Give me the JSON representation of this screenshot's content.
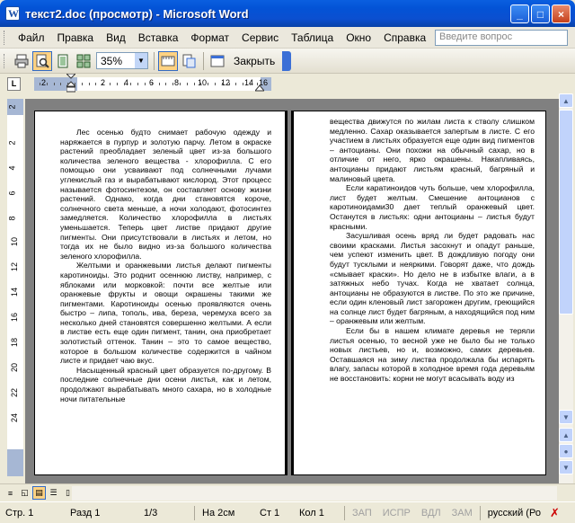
{
  "window": {
    "title": "текст2.doc (просмотр) - Microsoft Word",
    "buttons": [
      "_",
      "□",
      "×"
    ]
  },
  "menubar": {
    "items": [
      "Файл",
      "Правка",
      "Вид",
      "Вставка",
      "Формат",
      "Сервис",
      "Таблица",
      "Окно",
      "Справка"
    ],
    "help_placeholder": "Введите вопрос"
  },
  "toolbar": {
    "zoom_value": "35%",
    "close_label": "Закрыть",
    "icons": [
      "print-icon",
      "magnifier-icon",
      "one-page-icon",
      "multiple-pages-icon",
      "full-screen-icon",
      "shrink-to-fit-icon",
      "view-ruler-icon"
    ]
  },
  "ruler": {
    "corner_label": "L",
    "numbers": [
      "2",
      "2",
      "4",
      "6",
      "8",
      "10",
      "12",
      "14",
      "16"
    ],
    "vertical_numbers": [
      "2",
      "2",
      "4",
      "6",
      "8",
      "10",
      "12",
      "14",
      "16",
      "18",
      "20",
      "22",
      "24"
    ]
  },
  "page1": {
    "paragraphs": [
      "Лес осенью будто снимает рабочую одежду и наряжается в пурпур и золотую парчу. Летом в окраске растений преобладает зеленый цвет из-за большого количества зеленого вещества - хлорофилла. С его помощью они усваивают под солнечными лучами углекислый газ и вырабатывают кислород. Этот процесс называется фотосинтезом, он составляет основу жизни растений. Однако, когда дни становятся короче, солнечного света меньше, а ночи холодают, фотосинтез замедляется. Количество хлорофилла в листьях уменьшается. Теперь цвет листве придают другие пигменты. Они присутствовали в листьях и летом, но тогда их не было видно из-за большого количества зеленого хлорофилла.",
      "Желтыми и оранжевыми листья делают пигменты каротиноиды. Это роднит осеннюю листву, например, с яблоками или морковкой: почти все желтые или оранжевые фрукты и овощи окрашены такими же пигментами. Каротиноиды осенью проявляются очень быстро – липа, тополь, ива, береза, черемуха всего за несколько дней становятся совершенно желтыми. А если в листве есть еще один пигмент, танин, она приобретает золотистый оттенок. Танин – это то самое вещество, которое в большом количестве содержится в чайном листе и придает чаю вкус.",
      "Насыщенный красный цвет образуется по-другому. В последние солнечные дни осени листья, как и летом, продолжают вырабатывать много сахара, но в холодные ночи питательные"
    ]
  },
  "page2": {
    "paragraphs": [
      "вещества движутся по жилам листа к стволу слишком медленно. Сахар оказывается запертым в листе. С его участием в листьях образуется еще один вид пигментов – антоцианы. Они похожи на обычный сахар, но в отличие от него, ярко окрашены. Накапливаясь, антоцианы придают листьям красный, багряный и малиновый цвета.",
      "Если каратиноидов чуть больше, чем хлорофилла, лист будет желтым. Смешение антоцианов с каротиноидами30 дает теплый оранжевый цвет. Останутся в листьях: одни антоцианы – листья будут красными.",
      "Засушливая осень вряд ли будет радовать нас своими красками. Листья засохнут и опадут раньше, чем успеют изменить цвет. В дождливую погоду они будут тусклыми и неяркими. Говорят даже, что дождь «смывает краски». Но дело не в избытке влаги, а в затяжных небо тучах. Когда не хватает солнца, антоцианы не образуются в листве. По это же причине, если один кленовый лист загорожен другим, греющийся на солнце лист будет багряным, а находящийся под ним – оранжевым или желтым.",
      "Если бы в нашем климате деревья не теряли листья осенью, то весной уже не было бы не только новых листьев, но и, возможно, самих деревьев. Оставшаяся на зиму листва продолжала бы испарять влагу, запасы которой в холодное время года деревьям не восстановить: корни не могут всасывать воду из"
    ]
  },
  "statusbar": {
    "page": "Стр. 1",
    "section": "Разд 1",
    "pages": "1/3",
    "at": "На 2см",
    "line": "Ст 1",
    "col": "Кол 1",
    "rec": "ЗАП",
    "trk": "ИСПР",
    "ext": "ВДЛ",
    "ovr": "ЗАМ",
    "language": "русский (Ро"
  }
}
